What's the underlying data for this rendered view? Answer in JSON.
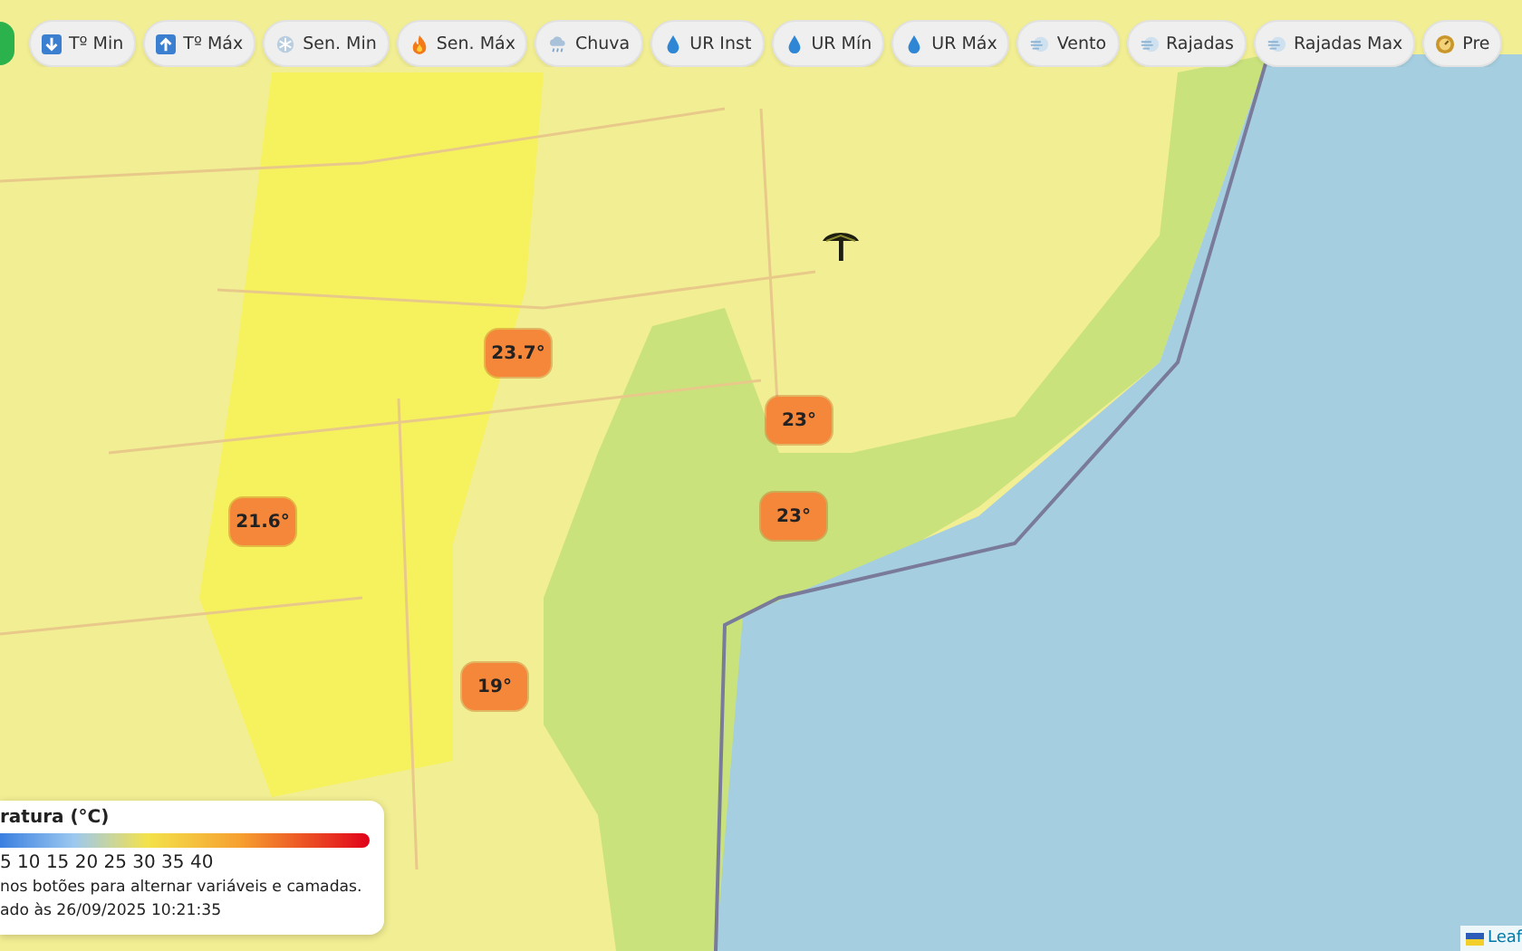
{
  "toolbar": {
    "buttons": [
      {
        "kind": "min",
        "label": "Tº Min"
      },
      {
        "kind": "max",
        "label": "Tº Máx"
      },
      {
        "kind": "cold",
        "label": "Sen. Min"
      },
      {
        "kind": "hot",
        "label": "Sen. Máx"
      },
      {
        "kind": "rain",
        "label": "Chuva"
      },
      {
        "kind": "drop",
        "label": "UR Inst"
      },
      {
        "kind": "drop",
        "label": "UR Mín"
      },
      {
        "kind": "drop",
        "label": "UR Máx"
      },
      {
        "kind": "wind",
        "label": "Vento"
      },
      {
        "kind": "wind",
        "label": "Rajadas"
      },
      {
        "kind": "wind",
        "label": "Rajadas Max"
      },
      {
        "kind": "pressure",
        "label": "Pre"
      }
    ]
  },
  "markers": [
    {
      "label": "23.7°"
    },
    {
      "label": "21.6°"
    },
    {
      "label": "23°"
    },
    {
      "label": "23°"
    },
    {
      "label": "19°"
    }
  ],
  "legend": {
    "title": "ratura (°C)",
    "scale": "5 10 15 20 25 30 35 40",
    "hint": "nos botões para alternar variáveis e camadas.",
    "updated": "ado às 26/09/2025 10:21:35"
  },
  "attribution": "Leaf"
}
